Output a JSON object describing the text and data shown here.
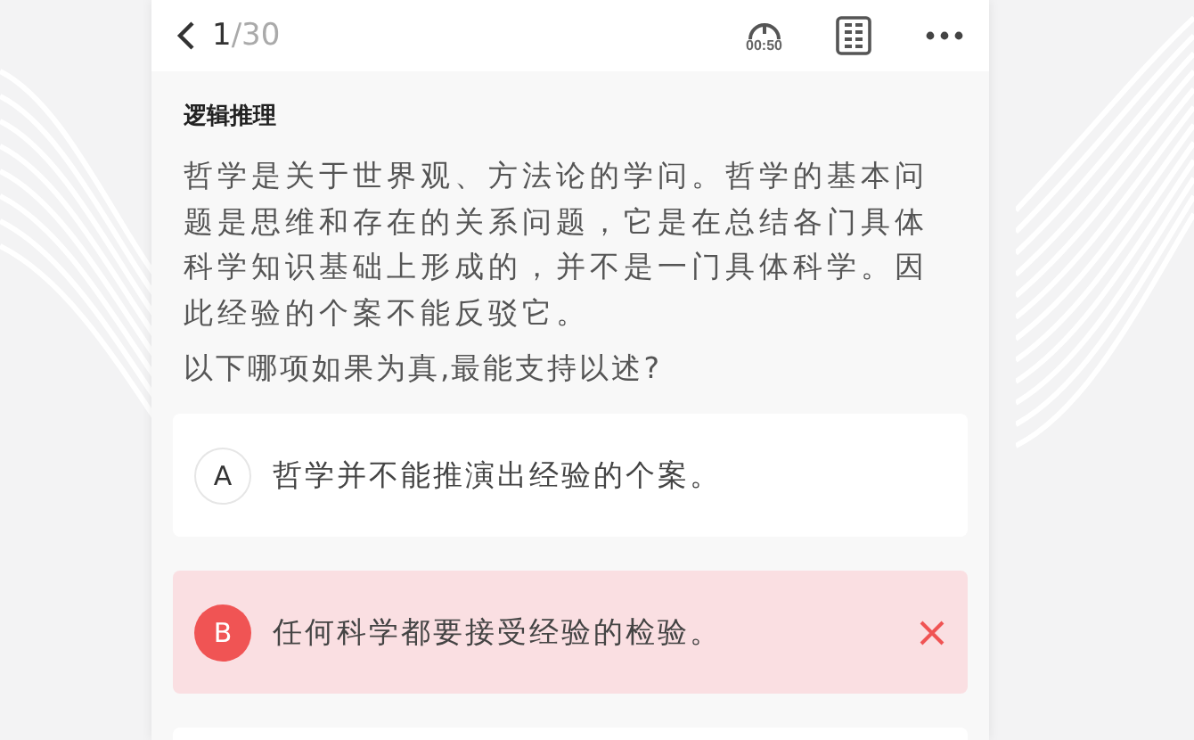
{
  "header": {
    "current": "1",
    "total": "/30",
    "timer": "00:50"
  },
  "category": "逻辑推理",
  "passage": "哲学是关于世界观、方法论的学问。哲学的基本问题是思维和存在的关系问题，它是在总结各门具体科学知识基础上形成的，并不是一门具体科学。因此经验的个案不能反驳它。",
  "question": "以下哪项如果为真,最能支持以述?",
  "options": [
    {
      "letter": "A",
      "text": "哲学并不能推演出经验的个案。",
      "selected": false,
      "wrong": false
    },
    {
      "letter": "B",
      "text": "任何科学都要接受经验的检验。",
      "selected": true,
      "wrong": true
    }
  ]
}
